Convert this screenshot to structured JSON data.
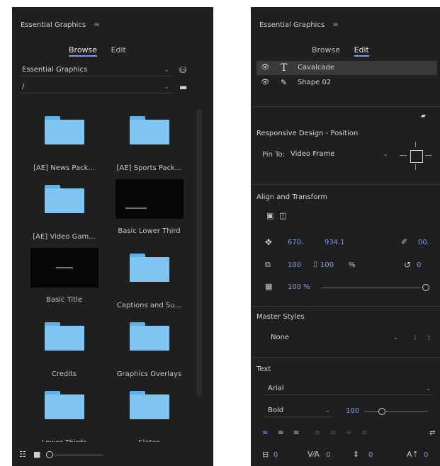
{
  "left_panel": {
    "title": "Essential Graphics",
    "menu_icon": "hamburger-icon",
    "tabs": [
      {
        "label": "Browse",
        "active": true
      },
      {
        "label": "Edit",
        "active": false
      }
    ],
    "library_dropdown": {
      "value": "Essential Graphics"
    },
    "search_dropdown": {
      "value": "/"
    },
    "items": [
      {
        "label": "[AE] News Pack...",
        "kind": "folder"
      },
      {
        "label": "[AE] Sports Pack...",
        "kind": "folder"
      },
      {
        "label": "[AE] Video Gam...",
        "kind": "folder"
      },
      {
        "label": "Basic Lower Third",
        "kind": "video"
      },
      {
        "label": "Basic Title",
        "kind": "video"
      },
      {
        "label": "Captions and Su...",
        "kind": "folder"
      },
      {
        "label": "Credits",
        "kind": "folder"
      },
      {
        "label": "Graphics Overlays",
        "kind": "folder"
      },
      {
        "label": "Lower Thirds",
        "kind": "folder"
      },
      {
        "label": "Slates",
        "kind": "folder"
      }
    ],
    "colors": {
      "folder": "#7fc5f2",
      "accent": "#7d98f2",
      "panel_bg": "#1f1f1f"
    }
  },
  "right_panel": {
    "title": "Essential Graphics",
    "menu_icon": "hamburger-icon",
    "tabs": [
      {
        "label": "Browse",
        "active": false
      },
      {
        "label": "Edit",
        "active": true
      }
    ],
    "layers": [
      {
        "name": "Cavalcade",
        "type_icon": "text-layer-icon",
        "selected": true
      },
      {
        "name": "Shape 02",
        "type_icon": "shape-layer-icon",
        "selected": false
      }
    ],
    "responsive": {
      "title": "Responsive Design - Position",
      "pin_label": "Pin To:",
      "pin_value": "Video Frame"
    },
    "align_transform": {
      "title": "Align and Transform",
      "position_x": "670.",
      "position_y": "934.1",
      "rotation_prefix": "00.",
      "scale_w": "100",
      "scale_h": "100",
      "scale_unit": "%",
      "rotation_value": "0",
      "opacity": "100 %",
      "opacity_end": "0"
    },
    "master_styles": {
      "title": "Master Styles",
      "value": "None"
    },
    "text": {
      "title": "Text",
      "font": "Arial",
      "style": "Bold",
      "size": "100"
    },
    "bottom_counts": [
      "0",
      "0",
      "0",
      "0"
    ]
  }
}
